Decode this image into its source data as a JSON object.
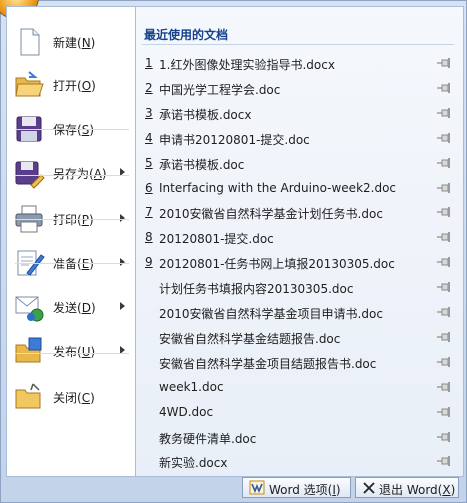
{
  "menu": {
    "items": [
      {
        "label": "新建(",
        "key": "N",
        "tail": ")",
        "has_submenu": false,
        "icon": "new-document-icon"
      },
      {
        "label": "打开(",
        "key": "O",
        "tail": ")",
        "has_submenu": false,
        "icon": "open-folder-icon"
      },
      {
        "label": "保存(",
        "key": "S",
        "tail": ")",
        "has_submenu": false,
        "icon": "save-floppy-icon"
      },
      {
        "label": "另存为(",
        "key": "A",
        "tail": ")",
        "has_submenu": true,
        "icon": "save-as-icon"
      },
      {
        "label": "打印(",
        "key": "P",
        "tail": ")",
        "has_submenu": true,
        "icon": "printer-icon"
      },
      {
        "label": "准备(",
        "key": "E",
        "tail": ")",
        "has_submenu": true,
        "icon": "prepare-icon"
      },
      {
        "label": "发送(",
        "key": "D",
        "tail": ")",
        "has_submenu": true,
        "icon": "send-icon"
      },
      {
        "label": "发布(",
        "key": "U",
        "tail": ")",
        "has_submenu": true,
        "icon": "publish-icon"
      },
      {
        "label": "关闭(",
        "key": "C",
        "tail": ")",
        "has_submenu": false,
        "icon": "close-folder-icon"
      }
    ]
  },
  "recent": {
    "title": "最近使用的文档",
    "items": [
      {
        "num": "1",
        "name": "1.红外图像处理实验指导书.docx"
      },
      {
        "num": "2",
        "name": "中国光学工程学会.doc"
      },
      {
        "num": "3",
        "name": "承诺书模板.docx"
      },
      {
        "num": "4",
        "name": "申请书20120801-提交.doc"
      },
      {
        "num": "5",
        "name": "承诺书模板.doc"
      },
      {
        "num": "6",
        "name": "Interfacing with the Arduino-week2.doc"
      },
      {
        "num": "7",
        "name": "2010安徽省自然科学基金计划任务书.doc"
      },
      {
        "num": "8",
        "name": "20120801-提交.doc"
      },
      {
        "num": "9",
        "name": "20120801-任务书网上填报20130305.doc"
      },
      {
        "num": "",
        "name": "计划任务书填报内容20130305.doc"
      },
      {
        "num": "",
        "name": "2010安徽省自然科学基金项目申请书.doc"
      },
      {
        "num": "",
        "name": "安徽省自然科学基金结题报告.doc"
      },
      {
        "num": "",
        "name": "安徽省自然科学基金项目结题报告书.doc"
      },
      {
        "num": "",
        "name": "week1.doc"
      },
      {
        "num": "",
        "name": "4WD.doc"
      },
      {
        "num": "",
        "name": "教务硬件清单.doc"
      },
      {
        "num": "",
        "name": "新实验.docx"
      }
    ]
  },
  "footer": {
    "options_label": "Word 选项(",
    "options_key": "I",
    "options_tail": ")",
    "exit_label": "退出 Word(",
    "exit_key": "X",
    "exit_tail": ")"
  },
  "colors": {
    "accent": "#15428b",
    "frame": "#c2d3ea",
    "highlight": "#ffd35a"
  }
}
